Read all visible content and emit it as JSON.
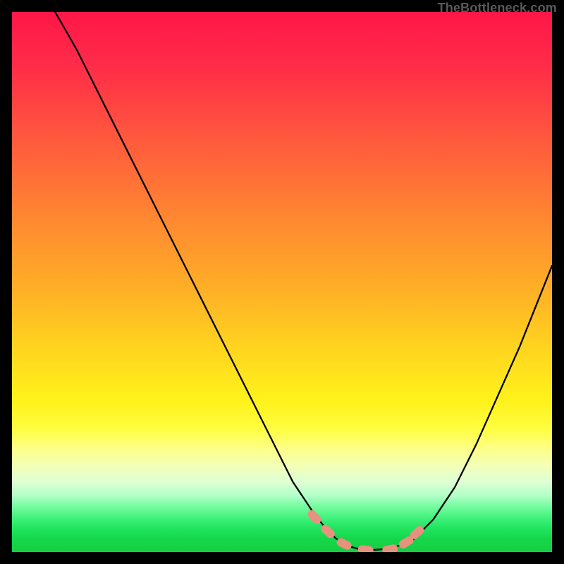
{
  "attribution": "TheBottleneck.com",
  "chart_data": {
    "type": "line",
    "title": "",
    "xlabel": "",
    "ylabel": "",
    "xlim": [
      0,
      100
    ],
    "ylim": [
      0,
      100
    ],
    "grid": false,
    "background_gradient": {
      "orientation": "vertical",
      "stops": [
        {
          "pos": 0.0,
          "color": "#ff1747"
        },
        {
          "pos": 0.24,
          "color": "#ff5a3d"
        },
        {
          "pos": 0.52,
          "color": "#ffb126"
        },
        {
          "pos": 0.72,
          "color": "#fff21b"
        },
        {
          "pos": 0.87,
          "color": "#deffd4"
        },
        {
          "pos": 1.0,
          "color": "#17ce42"
        }
      ]
    },
    "series": [
      {
        "name": "bottleneck-curve",
        "color": "#000000",
        "x": [
          8,
          12,
          16,
          20,
          24,
          28,
          32,
          36,
          40,
          44,
          48,
          52,
          56,
          58,
          60,
          62,
          64,
          67,
          70,
          74,
          78,
          82,
          86,
          90,
          94,
          98,
          100
        ],
        "y": [
          100,
          93,
          85,
          77,
          69,
          61,
          53,
          45,
          37,
          29,
          21,
          13,
          7,
          4.5,
          2.5,
          1.2,
          0.6,
          0.4,
          0.6,
          2,
          6,
          12,
          20,
          29,
          38,
          48,
          53
        ]
      }
    ],
    "markers": [
      {
        "name": "flat-zone-markers",
        "shape": "rounded-rect",
        "color": "#e8917f",
        "points": [
          {
            "x": 56.0,
            "y": 6.5
          },
          {
            "x": 58.5,
            "y": 3.8
          },
          {
            "x": 61.5,
            "y": 1.5
          },
          {
            "x": 65.5,
            "y": 0.4
          },
          {
            "x": 70.0,
            "y": 0.5
          },
          {
            "x": 73.0,
            "y": 1.8
          },
          {
            "x": 75.0,
            "y": 3.6
          }
        ]
      }
    ]
  }
}
